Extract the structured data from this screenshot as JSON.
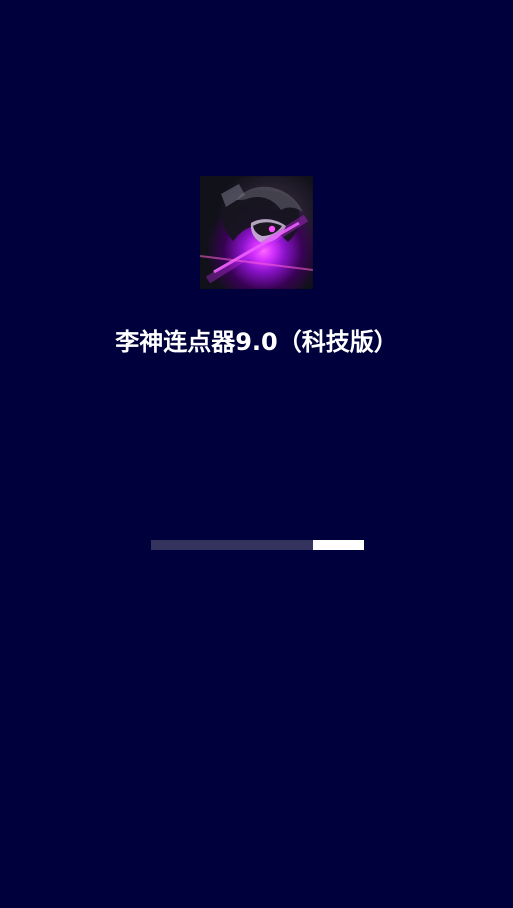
{
  "app": {
    "title": "李神连点器9.0（科技版）",
    "icon_name": "anime-character-icon"
  },
  "loading": {
    "progress_start_fraction": 0.76,
    "progress_end_fraction": 1.0
  },
  "colors": {
    "background": "#00003d",
    "track": "#33335d",
    "fill": "#ffffff",
    "title": "#ffffff",
    "icon_glow": "#d632ff"
  }
}
